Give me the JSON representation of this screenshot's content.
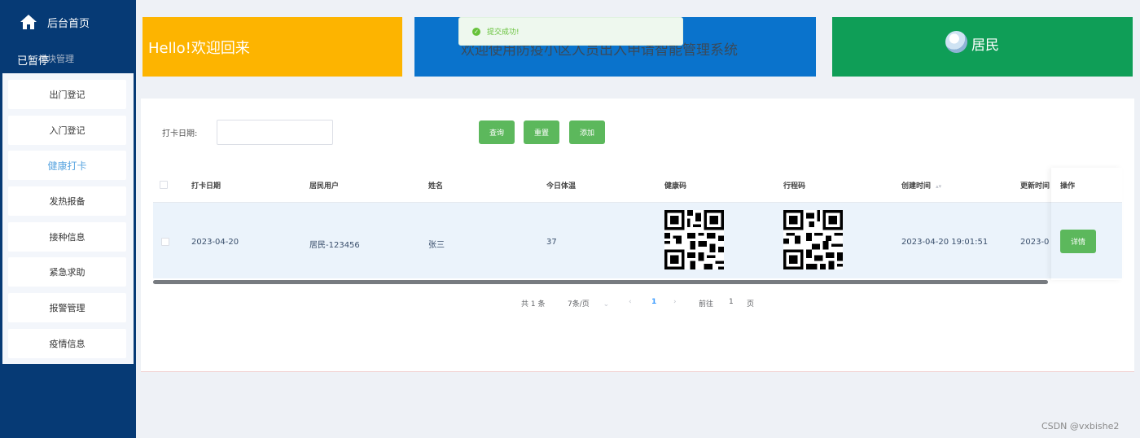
{
  "sidebar": {
    "home_label": "后台首页",
    "paused_label": "已暂停",
    "module_label": "模块管理",
    "items": [
      {
        "label": "出门登记"
      },
      {
        "label": "入门登记"
      },
      {
        "label": "健康打卡"
      },
      {
        "label": "发热报备"
      },
      {
        "label": "接种信息"
      },
      {
        "label": "紧急求助"
      },
      {
        "label": "报警管理"
      },
      {
        "label": "疫情信息"
      }
    ]
  },
  "cards": {
    "welcome": "Hello!欢迎回来",
    "system_title": "欢迎使用防疫小区人员出入申请智能管理系统",
    "role": "居民"
  },
  "toast": {
    "message": "提交成功!"
  },
  "filter": {
    "date_label": "打卡日期:",
    "date_value": "",
    "query_label": "查询",
    "reset_label": "重置",
    "add_label": "添加"
  },
  "table": {
    "headers": [
      "打卡日期",
      "居民用户",
      "姓名",
      "今日体温",
      "健康码",
      "行程码",
      "创建时间",
      "更新时间",
      "操作"
    ],
    "rows": [
      {
        "date": "2023-04-20",
        "user": "居民-123456",
        "name": "张三",
        "temp": "37",
        "created": "2023-04-20 19:01:51",
        "updated": "2023-0",
        "action": "详情"
      }
    ]
  },
  "pagination": {
    "total": "共 1 条",
    "page_size": "7条/页",
    "current": "1",
    "goto_label": "前往",
    "goto_value": "1",
    "page_suffix": "页"
  },
  "watermark": "CSDN @vxbishe2",
  "colors": {
    "sidebar_bg": "#063a75",
    "yellow_card": "#fdb400",
    "blue_card": "#0a73cc",
    "green_card": "#0f9e57",
    "button_green": "#5cb85c",
    "accent_blue": "#409eff"
  },
  "icons": [
    "home-icon",
    "module-icon",
    "check-circle-icon",
    "avatar-icon",
    "sort-caret-icon",
    "qr-code-icon",
    "chevron-left-icon",
    "chevron-right-icon",
    "chevron-down-icon"
  ]
}
